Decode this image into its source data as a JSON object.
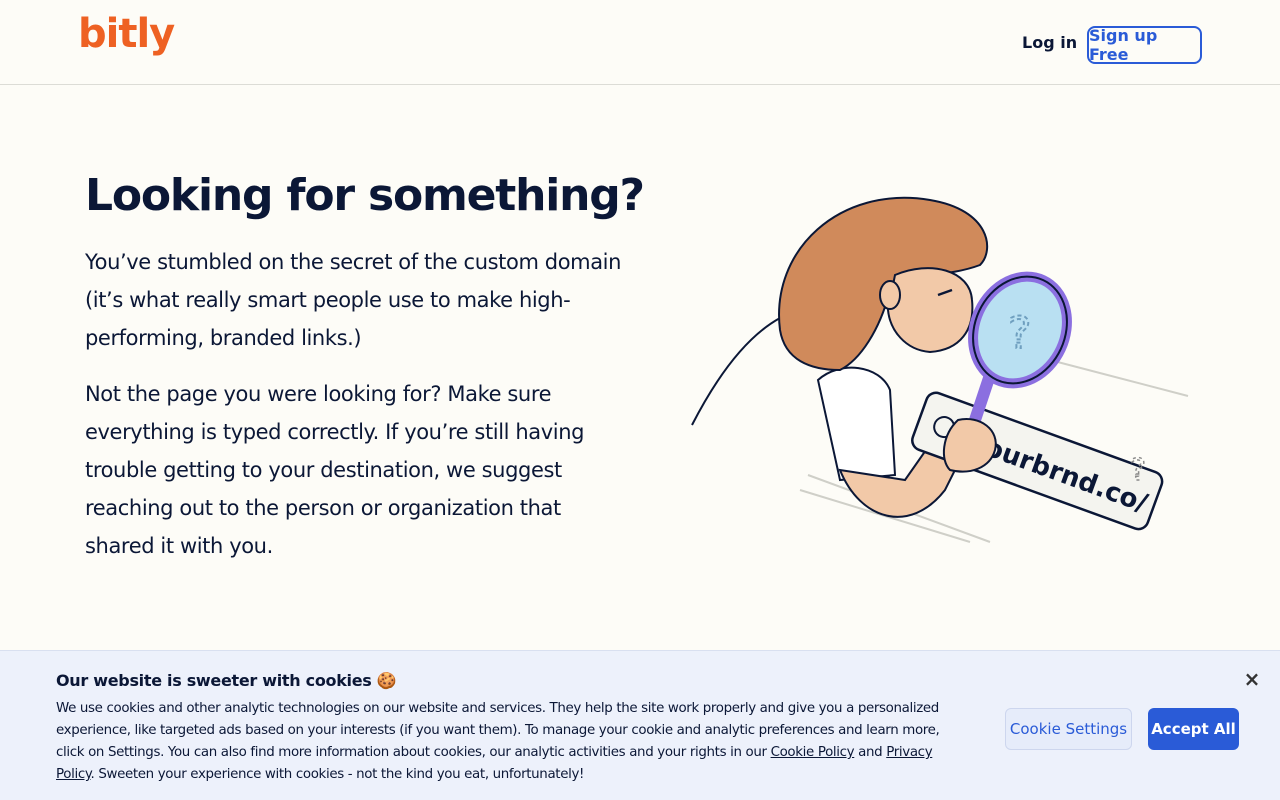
{
  "header": {
    "logo_text": "bitly",
    "login_label": "Log in",
    "signup_label": "Sign up Free"
  },
  "hero": {
    "title": "Looking for something?",
    "paragraph1": "You’ve stumbled on the secret of the custom domain (it’s what really smart people use to make high-performing, branded links.)",
    "paragraph2": "Not the page you were looking for? Make sure everything is typed correctly. If you’re still having trouble getting to your destination, we suggest reaching out to the person or organization that shared it with you."
  },
  "illustration": {
    "link_text": "yourbrnd.co/"
  },
  "cookie_banner": {
    "title": "Our website is sweeter with cookies",
    "title_emoji": "🍪",
    "text_part1": "We use cookies and other analytic technologies on our website and services. They help the site work properly and give you a personalized experience, like targeted ads based on your interests (if you want them). To manage your cookie and analytic preferences and learn more, click on Settings. You can also find more information about cookies, our analytic activities and your rights in our ",
    "cookie_policy_link": "Cookie Policy",
    "text_and": " and ",
    "privacy_policy_link": "Privacy Policy",
    "text_part2": ". Sweeten your experience with cookies - not the kind you eat, unfortunately!",
    "settings_label": "Cookie Settings",
    "accept_label": "Accept All",
    "close_icon": "×"
  },
  "colors": {
    "brand_orange": "#ee6123",
    "accent_blue": "#2a5bd7",
    "text_navy": "#0b1736",
    "page_bg": "#fdfcf7",
    "banner_bg": "#edf1fb"
  }
}
